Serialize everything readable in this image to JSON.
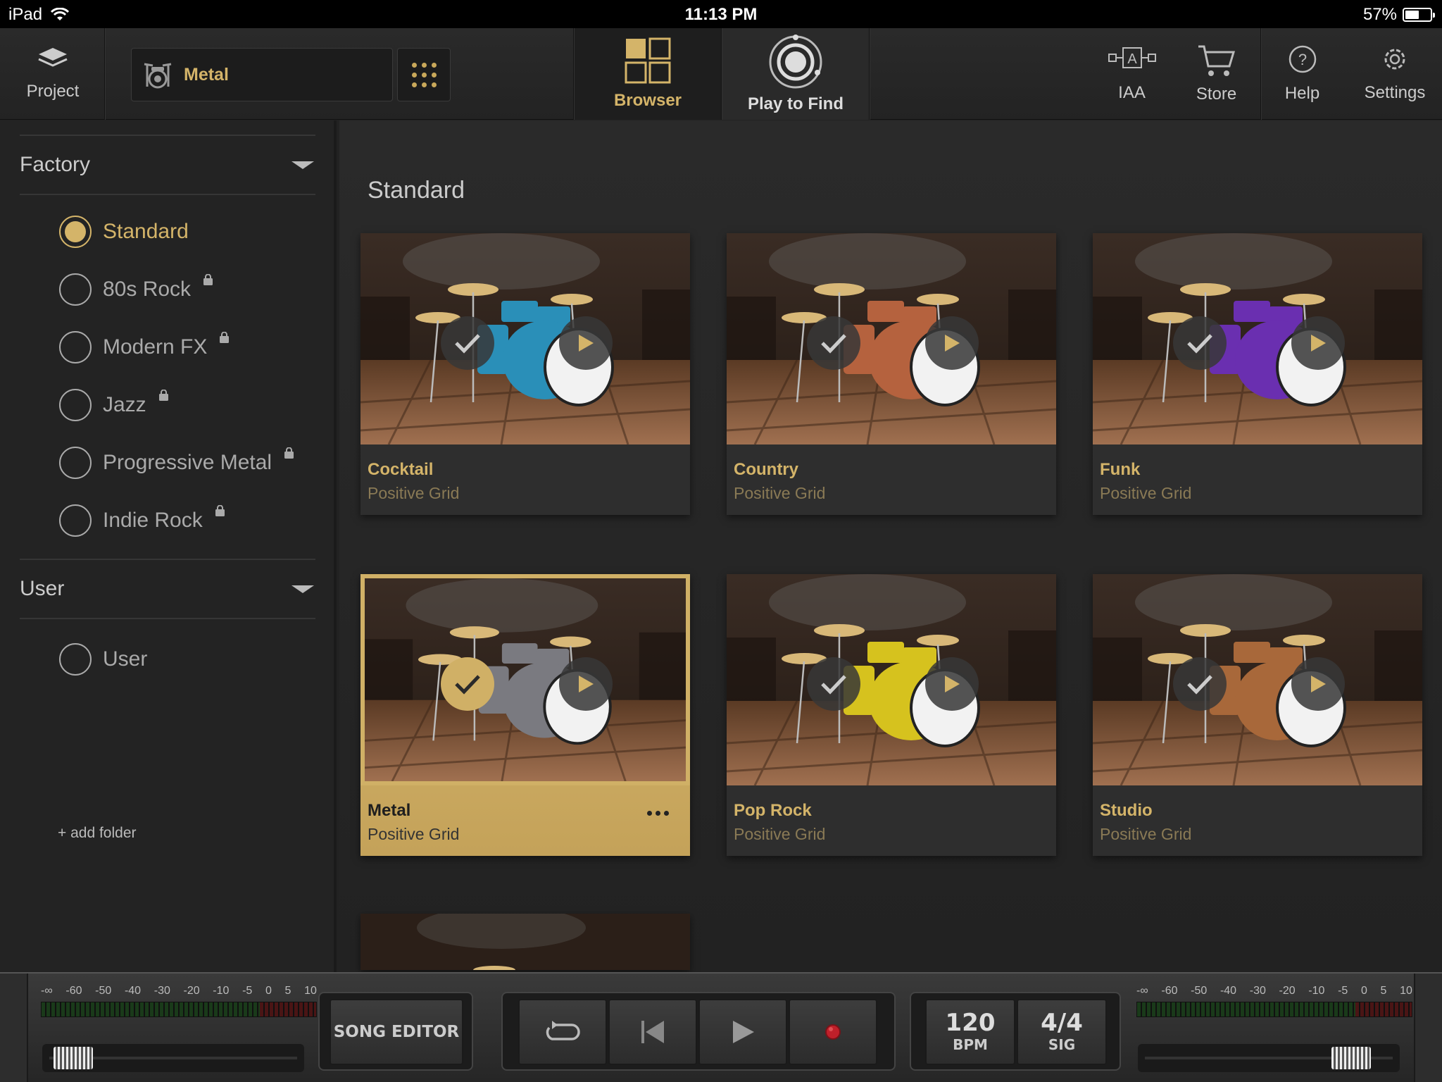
{
  "status_bar": {
    "device": "iPad",
    "time": "11:13 PM",
    "battery": "57%",
    "battery_level": 0.57
  },
  "toolbar": {
    "project_label": "Project",
    "kit_name": "Metal",
    "tabs": [
      {
        "label": "Browser",
        "active": true
      },
      {
        "label": "Play to Find",
        "active": false
      }
    ],
    "iaa_label": "IAA",
    "store_label": "Store",
    "help_label": "Help",
    "settings_label": "Settings"
  },
  "sidebar": {
    "factory_label": "Factory",
    "factory_items": [
      {
        "label": "Standard",
        "selected": true,
        "locked": false
      },
      {
        "label": "80s Rock",
        "selected": false,
        "locked": true
      },
      {
        "label": "Modern FX",
        "selected": false,
        "locked": true
      },
      {
        "label": "Jazz",
        "selected": false,
        "locked": true
      },
      {
        "label": "Progressive Metal",
        "selected": false,
        "locked": true
      },
      {
        "label": "Indie Rock",
        "selected": false,
        "locked": true
      }
    ],
    "user_label": "User",
    "user_items": [
      {
        "label": "User",
        "selected": false,
        "locked": false
      }
    ],
    "add_folder_label": "+ add folder"
  },
  "main": {
    "section_title": "Standard",
    "kits": [
      {
        "title": "Cocktail",
        "author": "Positive Grid",
        "selected": false,
        "drum_color": "#2a8fb8"
      },
      {
        "title": "Country",
        "author": "Positive Grid",
        "selected": false,
        "drum_color": "#b5623e"
      },
      {
        "title": "Funk",
        "author": "Positive Grid",
        "selected": false,
        "drum_color": "#6a2fb0"
      },
      {
        "title": "Metal",
        "author": "Positive Grid",
        "selected": true,
        "drum_color": "#7a7a80"
      },
      {
        "title": "Pop Rock",
        "author": "Positive Grid",
        "selected": false,
        "drum_color": "#d6c21e"
      },
      {
        "title": "Studio",
        "author": "Positive Grid",
        "selected": false,
        "drum_color": "#a8683a"
      }
    ]
  },
  "transport": {
    "meter_scale": [
      "-∞",
      "-60",
      "-50",
      "-40",
      "-30",
      "-20",
      "-10",
      "-5",
      "0",
      "5",
      "10"
    ],
    "song_editor_label": "SONG EDITOR",
    "bpm_value": "120",
    "bpm_label": "BPM",
    "sig_value": "4/4",
    "sig_label": "SIG",
    "left_fader_level": 0.04,
    "right_fader_level": 0.88
  },
  "colors": {
    "accent": "#d4b469",
    "record": "#c0202a"
  }
}
